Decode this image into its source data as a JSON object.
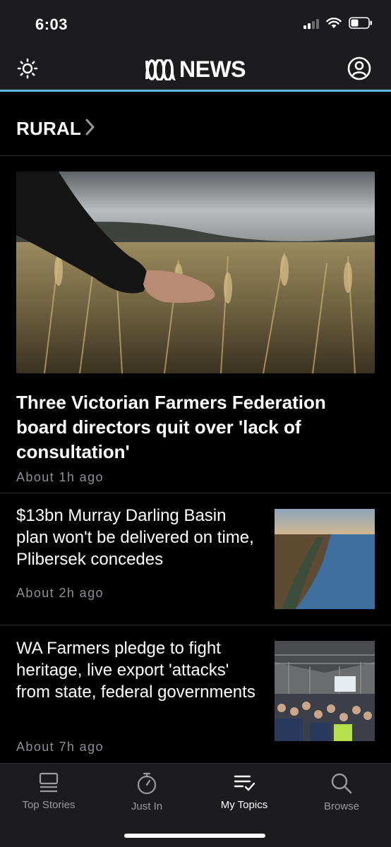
{
  "status_bar": {
    "time": "6:03"
  },
  "header": {
    "logo_text": "NEWS"
  },
  "topic": {
    "title": "RURAL"
  },
  "stories": [
    {
      "title": "Three Victorian Farmers Federation board directors quit over 'lack of consultation'",
      "time": "About 1h ago"
    },
    {
      "title": "$13bn Murray Darling Basin plan won't be delivered on time, Plibersek concedes",
      "time": "About 2h ago"
    },
    {
      "title": "WA Farmers pledge to fight heritage, live export 'attacks' from state, federal governments",
      "time": "About 7h ago"
    }
  ],
  "tabs": [
    {
      "label": "Top Stories",
      "icon": "stack-icon"
    },
    {
      "label": "Just In",
      "icon": "stopwatch-icon"
    },
    {
      "label": "My Topics",
      "icon": "checklist-icon"
    },
    {
      "label": "Browse",
      "icon": "search-icon"
    }
  ],
  "active_tab": "My Topics",
  "colors": {
    "accent": "#5fb8e6",
    "background": "#000000",
    "bar": "#1c1c1e",
    "muted_text": "#8e8e93"
  }
}
